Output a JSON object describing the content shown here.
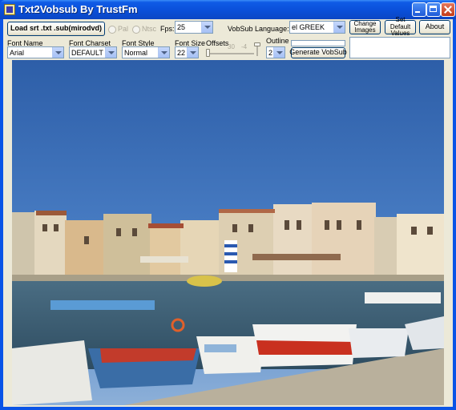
{
  "window": {
    "title": "Txt2Vobsub By TrustFm"
  },
  "toolbar": {
    "load_button": "Load srt .txt .sub(mirodvd)",
    "pal_label": "Pal",
    "ntsc_label": "Ntsc",
    "fps_label": "Fps:",
    "fps_value": "25",
    "vobsub_language_label": "VobSub Language:",
    "vobsub_language_value": "el GREEK",
    "change_images_button": "Change Images",
    "set_default_values_button": "Set Default Values",
    "about_button": "About",
    "font_name_label": "Font Name",
    "font_name_value": "Arial",
    "font_charset_label": "Font Charset",
    "font_charset_value": "DEFAULT",
    "font_style_label": "Font Style",
    "font_style_value": "Normal",
    "font_size_label": "Font Size",
    "font_size_value": "22",
    "offsets_label": "Offsets",
    "offset_x_value": "30",
    "offset_y_value": "-4",
    "outline_label": "Outline",
    "outline_value": "2",
    "generate_button": "Generate VobSub"
  },
  "colors": {
    "title_bar": "#0a54e6",
    "client_bg": "#ece9d8",
    "sky": "#3f73c0",
    "sea": "#3c5f78",
    "button_border": "#003c74"
  },
  "icons": {
    "app": "vobsub-app-icon",
    "minimize": "minimize-icon",
    "maximize": "maximize-icon",
    "close": "close-icon",
    "dropdown": "chevron-down-icon"
  }
}
